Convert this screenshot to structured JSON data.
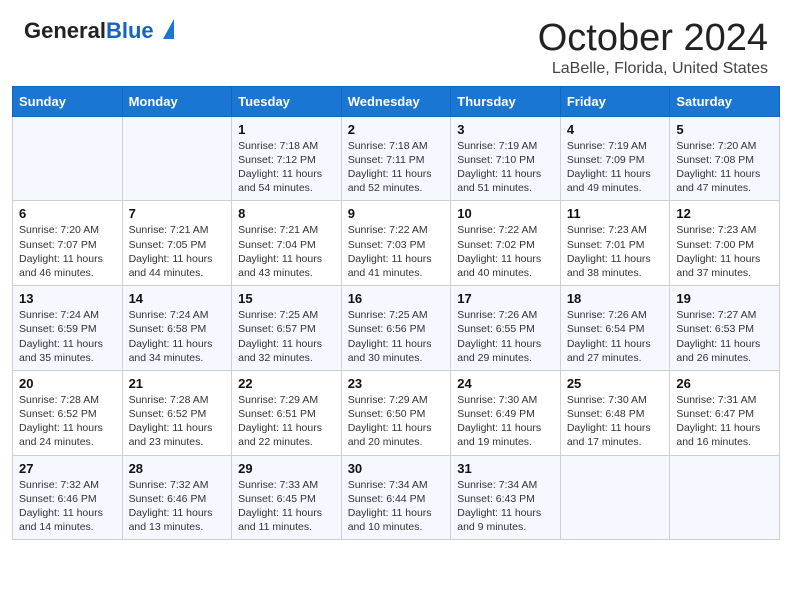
{
  "header": {
    "logo_general": "General",
    "logo_blue": "Blue",
    "title": "October 2024",
    "subtitle": "LaBelle, Florida, United States"
  },
  "calendar": {
    "days_of_week": [
      "Sunday",
      "Monday",
      "Tuesday",
      "Wednesday",
      "Thursday",
      "Friday",
      "Saturday"
    ],
    "weeks": [
      [
        {
          "day": "",
          "sunrise": "",
          "sunset": "",
          "daylight": ""
        },
        {
          "day": "",
          "sunrise": "",
          "sunset": "",
          "daylight": ""
        },
        {
          "day": "1",
          "sunrise": "Sunrise: 7:18 AM",
          "sunset": "Sunset: 7:12 PM",
          "daylight": "Daylight: 11 hours and 54 minutes."
        },
        {
          "day": "2",
          "sunrise": "Sunrise: 7:18 AM",
          "sunset": "Sunset: 7:11 PM",
          "daylight": "Daylight: 11 hours and 52 minutes."
        },
        {
          "day": "3",
          "sunrise": "Sunrise: 7:19 AM",
          "sunset": "Sunset: 7:10 PM",
          "daylight": "Daylight: 11 hours and 51 minutes."
        },
        {
          "day": "4",
          "sunrise": "Sunrise: 7:19 AM",
          "sunset": "Sunset: 7:09 PM",
          "daylight": "Daylight: 11 hours and 49 minutes."
        },
        {
          "day": "5",
          "sunrise": "Sunrise: 7:20 AM",
          "sunset": "Sunset: 7:08 PM",
          "daylight": "Daylight: 11 hours and 47 minutes."
        }
      ],
      [
        {
          "day": "6",
          "sunrise": "Sunrise: 7:20 AM",
          "sunset": "Sunset: 7:07 PM",
          "daylight": "Daylight: 11 hours and 46 minutes."
        },
        {
          "day": "7",
          "sunrise": "Sunrise: 7:21 AM",
          "sunset": "Sunset: 7:05 PM",
          "daylight": "Daylight: 11 hours and 44 minutes."
        },
        {
          "day": "8",
          "sunrise": "Sunrise: 7:21 AM",
          "sunset": "Sunset: 7:04 PM",
          "daylight": "Daylight: 11 hours and 43 minutes."
        },
        {
          "day": "9",
          "sunrise": "Sunrise: 7:22 AM",
          "sunset": "Sunset: 7:03 PM",
          "daylight": "Daylight: 11 hours and 41 minutes."
        },
        {
          "day": "10",
          "sunrise": "Sunrise: 7:22 AM",
          "sunset": "Sunset: 7:02 PM",
          "daylight": "Daylight: 11 hours and 40 minutes."
        },
        {
          "day": "11",
          "sunrise": "Sunrise: 7:23 AM",
          "sunset": "Sunset: 7:01 PM",
          "daylight": "Daylight: 11 hours and 38 minutes."
        },
        {
          "day": "12",
          "sunrise": "Sunrise: 7:23 AM",
          "sunset": "Sunset: 7:00 PM",
          "daylight": "Daylight: 11 hours and 37 minutes."
        }
      ],
      [
        {
          "day": "13",
          "sunrise": "Sunrise: 7:24 AM",
          "sunset": "Sunset: 6:59 PM",
          "daylight": "Daylight: 11 hours and 35 minutes."
        },
        {
          "day": "14",
          "sunrise": "Sunrise: 7:24 AM",
          "sunset": "Sunset: 6:58 PM",
          "daylight": "Daylight: 11 hours and 34 minutes."
        },
        {
          "day": "15",
          "sunrise": "Sunrise: 7:25 AM",
          "sunset": "Sunset: 6:57 PM",
          "daylight": "Daylight: 11 hours and 32 minutes."
        },
        {
          "day": "16",
          "sunrise": "Sunrise: 7:25 AM",
          "sunset": "Sunset: 6:56 PM",
          "daylight": "Daylight: 11 hours and 30 minutes."
        },
        {
          "day": "17",
          "sunrise": "Sunrise: 7:26 AM",
          "sunset": "Sunset: 6:55 PM",
          "daylight": "Daylight: 11 hours and 29 minutes."
        },
        {
          "day": "18",
          "sunrise": "Sunrise: 7:26 AM",
          "sunset": "Sunset: 6:54 PM",
          "daylight": "Daylight: 11 hours and 27 minutes."
        },
        {
          "day": "19",
          "sunrise": "Sunrise: 7:27 AM",
          "sunset": "Sunset: 6:53 PM",
          "daylight": "Daylight: 11 hours and 26 minutes."
        }
      ],
      [
        {
          "day": "20",
          "sunrise": "Sunrise: 7:28 AM",
          "sunset": "Sunset: 6:52 PM",
          "daylight": "Daylight: 11 hours and 24 minutes."
        },
        {
          "day": "21",
          "sunrise": "Sunrise: 7:28 AM",
          "sunset": "Sunset: 6:52 PM",
          "daylight": "Daylight: 11 hours and 23 minutes."
        },
        {
          "day": "22",
          "sunrise": "Sunrise: 7:29 AM",
          "sunset": "Sunset: 6:51 PM",
          "daylight": "Daylight: 11 hours and 22 minutes."
        },
        {
          "day": "23",
          "sunrise": "Sunrise: 7:29 AM",
          "sunset": "Sunset: 6:50 PM",
          "daylight": "Daylight: 11 hours and 20 minutes."
        },
        {
          "day": "24",
          "sunrise": "Sunrise: 7:30 AM",
          "sunset": "Sunset: 6:49 PM",
          "daylight": "Daylight: 11 hours and 19 minutes."
        },
        {
          "day": "25",
          "sunrise": "Sunrise: 7:30 AM",
          "sunset": "Sunset: 6:48 PM",
          "daylight": "Daylight: 11 hours and 17 minutes."
        },
        {
          "day": "26",
          "sunrise": "Sunrise: 7:31 AM",
          "sunset": "Sunset: 6:47 PM",
          "daylight": "Daylight: 11 hours and 16 minutes."
        }
      ],
      [
        {
          "day": "27",
          "sunrise": "Sunrise: 7:32 AM",
          "sunset": "Sunset: 6:46 PM",
          "daylight": "Daylight: 11 hours and 14 minutes."
        },
        {
          "day": "28",
          "sunrise": "Sunrise: 7:32 AM",
          "sunset": "Sunset: 6:46 PM",
          "daylight": "Daylight: 11 hours and 13 minutes."
        },
        {
          "day": "29",
          "sunrise": "Sunrise: 7:33 AM",
          "sunset": "Sunset: 6:45 PM",
          "daylight": "Daylight: 11 hours and 11 minutes."
        },
        {
          "day": "30",
          "sunrise": "Sunrise: 7:34 AM",
          "sunset": "Sunset: 6:44 PM",
          "daylight": "Daylight: 11 hours and 10 minutes."
        },
        {
          "day": "31",
          "sunrise": "Sunrise: 7:34 AM",
          "sunset": "Sunset: 6:43 PM",
          "daylight": "Daylight: 11 hours and 9 minutes."
        },
        {
          "day": "",
          "sunrise": "",
          "sunset": "",
          "daylight": ""
        },
        {
          "day": "",
          "sunrise": "",
          "sunset": "",
          "daylight": ""
        }
      ]
    ]
  }
}
